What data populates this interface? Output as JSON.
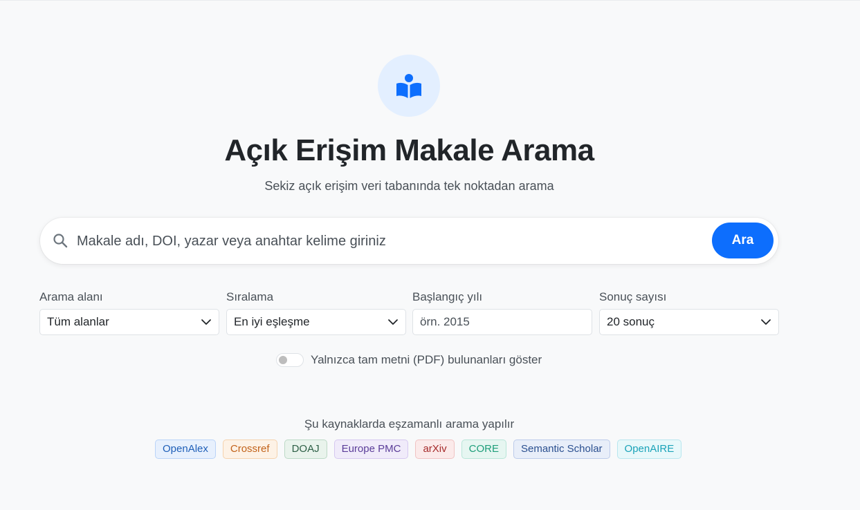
{
  "header": {
    "logo_icon": "reader-book-icon",
    "title": "Açık Erişim Makale Arama",
    "subtitle": "Sekiz açık erişim veri tabanında tek noktadan arama"
  },
  "search": {
    "placeholder": "Makale adı, DOI, yazar veya anahtar kelime giriniz",
    "value": "",
    "button_label": "Ara"
  },
  "filters": {
    "field": {
      "label": "Arama alanı",
      "value": "Tüm alanlar"
    },
    "sort": {
      "label": "Sıralama",
      "value": "En iyi eşleşme"
    },
    "year": {
      "label": "Başlangıç yılı",
      "placeholder": "örn. 2015"
    },
    "count": {
      "label": "Sonuç sayısı",
      "value": "20 sonuç"
    }
  },
  "toggle": {
    "label": "Yalnızca tam metni (PDF) bulunanları göster",
    "checked": false
  },
  "sources": {
    "title": "Şu kaynaklarda eşzamanlı arama yapılır",
    "items": [
      {
        "name": "OpenAlex",
        "color": "#1f5fb8",
        "bg": "#e7f0fd",
        "border": "#b9d3f8"
      },
      {
        "name": "Crossref",
        "color": "#c2621a",
        "bg": "#fdf2e6",
        "border": "#f5d2ad"
      },
      {
        "name": "DOAJ",
        "color": "#2d5f46",
        "bg": "#e9f3ec",
        "border": "#bcd9c6"
      },
      {
        "name": "Europe PMC",
        "color": "#5b3d99",
        "bg": "#f0ebfa",
        "border": "#d5c8f0"
      },
      {
        "name": "arXiv",
        "color": "#a52a2a",
        "bg": "#fbeaea",
        "border": "#f0c3c3"
      },
      {
        "name": "CORE",
        "color": "#1e9e7a",
        "bg": "#e6f6f1",
        "border": "#b8e6d8"
      },
      {
        "name": "Semantic Scholar",
        "color": "#2a4f8f",
        "bg": "#e8eef9",
        "border": "#bccbea"
      },
      {
        "name": "OpenAIRE",
        "color": "#1aa3b8",
        "bg": "#e8f8fa",
        "border": "#b7e6ee"
      }
    ]
  },
  "colors": {
    "accent": "#0d6efd",
    "background": "#f8f9fa"
  }
}
